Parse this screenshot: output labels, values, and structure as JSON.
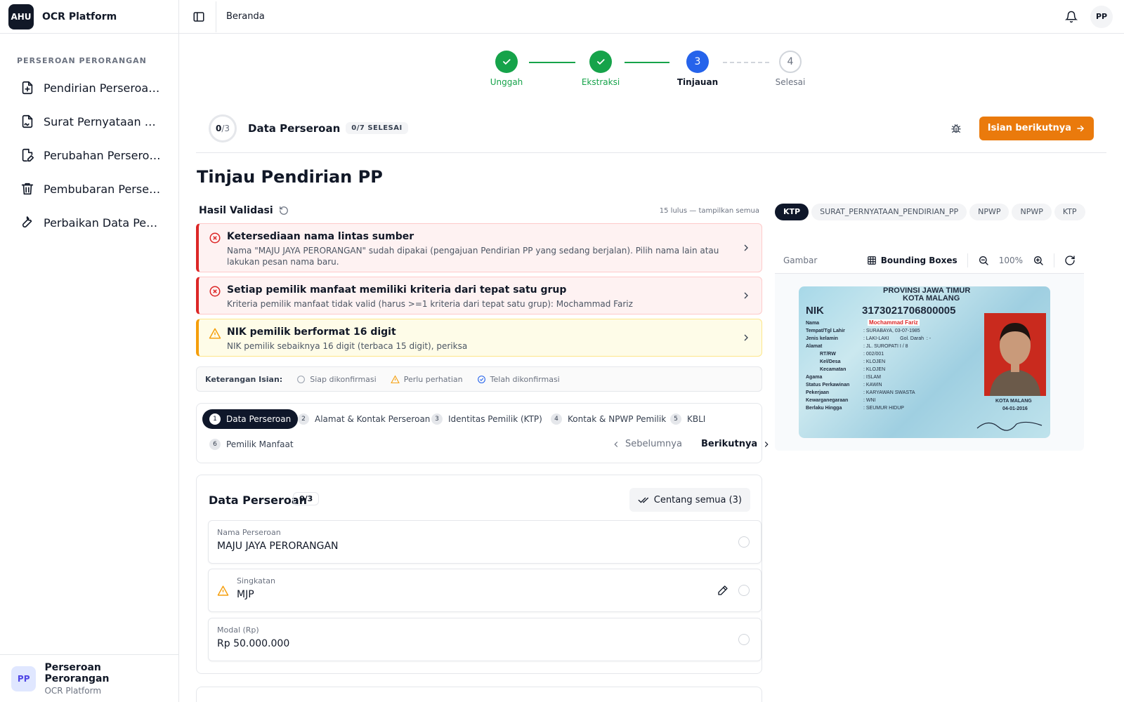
{
  "sidebar": {
    "logo": "AHU",
    "app_name": "OCR Platform",
    "group_label": "PERSEROAN PERORANGAN",
    "items": [
      {
        "label": "Pendirian Perseroan ...",
        "icon": "file-plus-icon"
      },
      {
        "label": "Surat Pernyataan Pe...",
        "icon": "file-signature-icon"
      },
      {
        "label": "Perubahan Perseroa...",
        "icon": "file-edit-icon"
      },
      {
        "label": "Pembubaran Persero...",
        "icon": "trash-icon"
      },
      {
        "label": "Perbaikan Data Pers...",
        "icon": "wrench-icon"
      }
    ],
    "footer": {
      "avatar": "PP",
      "name": "Perseroan Perorangan",
      "sub": "OCR Platform"
    }
  },
  "topbar": {
    "breadcrumb": "Beranda",
    "avatar": "PP"
  },
  "stepper": {
    "steps": [
      {
        "label": "Unggah",
        "state": "done"
      },
      {
        "label": "Ekstraksi",
        "state": "done"
      },
      {
        "label": "Tinjauan",
        "state": "active",
        "num": "3"
      },
      {
        "label": "Selesai",
        "state": "pending",
        "num": "4"
      }
    ]
  },
  "header_card": {
    "progress_done": "0",
    "progress_total": "/3",
    "title": "Data Perseroan",
    "badge": "0/7 SELESAI",
    "next_button": "Isian berikutnya"
  },
  "page_title": "Tinjau Pendirian PP",
  "validation": {
    "title": "Hasil Validasi",
    "summary": "15 lulus — tampilkan semua",
    "alerts": [
      {
        "level": "error",
        "title": "Ketersediaan nama lintas sumber",
        "desc": "Nama \"MAJU JAYA PERORANGAN\" sudah dipakai (pengajuan Pendirian PP yang sedang berjalan). Pilih nama lain atau lakukan pesan nama baru."
      },
      {
        "level": "error",
        "title": "Setiap pemilik manfaat memiliki kriteria dari tepat satu grup",
        "desc": "Kriteria pemilik manfaat tidak valid (harus >=1 kriteria dari tepat satu grup): Mochammad Fariz"
      },
      {
        "level": "warning",
        "title": "NIK pemilik berformat 16 digit",
        "desc": "NIK pemilik sebaiknya 16 digit (terbaca 15 digit), periksa"
      }
    ]
  },
  "legend": {
    "title": "Keterangan Isian:",
    "items": [
      "Siap dikonfirmasi",
      "Perlu perhatian",
      "Telah dikonfirmasi"
    ]
  },
  "form_tabs": {
    "tabs": [
      {
        "num": "1",
        "label": "Data Perseroan"
      },
      {
        "num": "2",
        "label": "Alamat & Kontak Perseroan"
      },
      {
        "num": "3",
        "label": "Identitas Pemilik (KTP)"
      },
      {
        "num": "4",
        "label": "Kontak & NPWP Pemilik"
      },
      {
        "num": "5",
        "label": "KBLI"
      },
      {
        "num": "6",
        "label": "Pemilik Manfaat"
      }
    ],
    "prev": "Sebelumnya",
    "next": "Berikutnya"
  },
  "form": {
    "title": "Data Perseroan",
    "badge": "0/3",
    "check_all": "Centang semua (3)",
    "fields": [
      {
        "label": "Nama Perseroan",
        "value": "MAJU JAYA PERORANGAN"
      },
      {
        "label": "Singkatan",
        "value": "MJP"
      },
      {
        "label": "Modal (Rp)",
        "value": "Rp 50.000.000"
      }
    ]
  },
  "doc_panel": {
    "tabs": [
      "KTP",
      "SURAT_PERNYATAAN_PENDIRIAN_PP",
      "NPWP",
      "NPWP",
      "KTP"
    ],
    "viewer_label": "Gambar",
    "bbox_label": "Bounding Boxes",
    "zoom": "100%",
    "ktp": {
      "province": "PROVINSI JAWA TIMUR",
      "city": "KOTA MALANG",
      "nik_label": "NIK",
      "nik": "3173021706800005",
      "rows": [
        [
          "Nama",
          "Mochammad Fariz"
        ],
        [
          "Tempat/Tgl Lahir",
          ": SURABAYA, 03-07-1985"
        ],
        [
          "Jenis kelamin",
          ": LAKI-LAKI        Gol. Darah  : -"
        ],
        [
          "Alamat",
          ": JL. SUROPATI I / 8"
        ],
        [
          "RT/RW",
          ": 002/001"
        ],
        [
          "Kel/Desa",
          ": KLOJEN"
        ],
        [
          "Kecamatan",
          ": KLOJEN"
        ],
        [
          "Agama",
          ": ISLAM"
        ],
        [
          "Status Perkawinan",
          ": KAWIN"
        ],
        [
          "Pekerjaan",
          ": KARYAWAN SWASTA"
        ],
        [
          "Kewarganegaraan",
          ": WNI"
        ],
        [
          "Berlaku Hingga",
          ": SEUMUR HIDUP"
        ]
      ],
      "issue_city": "KOTA MALANG",
      "issue_date": "04-01-2016"
    }
  }
}
